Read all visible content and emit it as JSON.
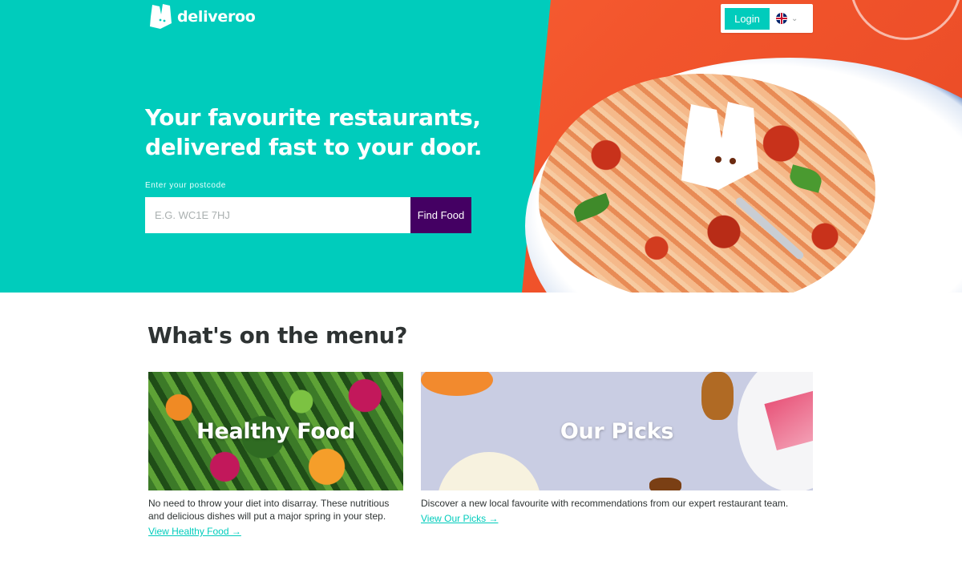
{
  "brand": {
    "name": "deliveroo",
    "logo_icon": "kangaroo-logo-icon",
    "accent": "#00ccbc",
    "secondary": "#440063"
  },
  "header": {
    "login_label": "Login",
    "language_icon": "uk-flag-icon"
  },
  "hero": {
    "headline_line1": "Your favourite restaurants,",
    "headline_line2": "delivered fast to your door.",
    "postcode_label": "Enter your postcode",
    "postcode_placeholder": "E.G. WC1E 7HJ",
    "postcode_value": "",
    "find_button": "Find Food"
  },
  "menu": {
    "title": "What's on the menu?",
    "cards": [
      {
        "image_label": "Healthy Food",
        "description": "No need to throw your diet into disarray. These nutritious and delicious dishes will put a major spring in your step.",
        "link": "View Healthy Food →"
      },
      {
        "image_label": "Our Picks",
        "description": "Discover a new local favourite with recommendations from our expert restaurant team.",
        "link": "View Our Picks →"
      }
    ]
  }
}
